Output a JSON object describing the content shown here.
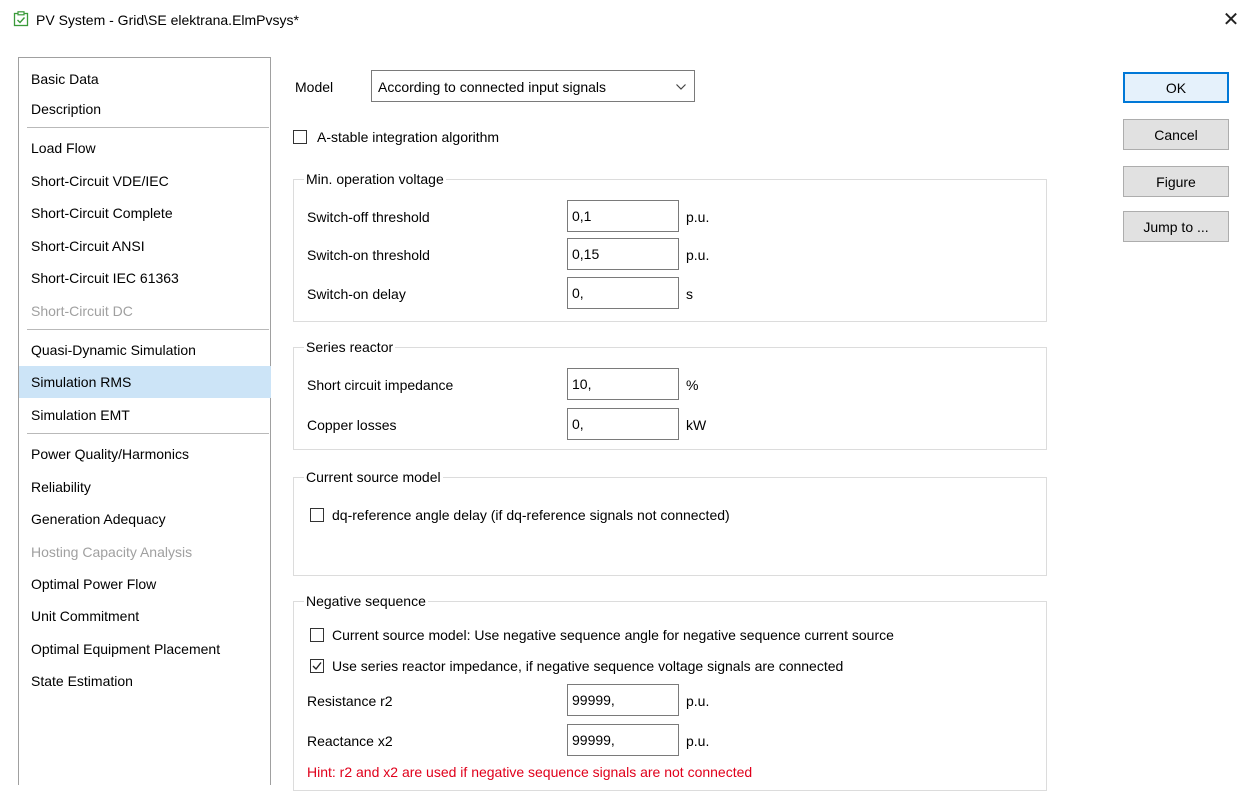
{
  "window": {
    "title": "PV System - Grid\\SE elektrana.ElmPvsys*",
    "close_glyph": "✕",
    "icon": "element-icon"
  },
  "sidebar": {
    "items": [
      {
        "label": "Basic Data"
      },
      {
        "label": "Description"
      },
      {
        "label": "Load Flow"
      },
      {
        "label": "Short-Circuit VDE/IEC"
      },
      {
        "label": "Short-Circuit Complete"
      },
      {
        "label": "Short-Circuit ANSI"
      },
      {
        "label": "Short-Circuit IEC 61363"
      },
      {
        "label": "Short-Circuit DC"
      },
      {
        "label": "Quasi-Dynamic Simulation"
      },
      {
        "label": "Simulation RMS"
      },
      {
        "label": "Simulation EMT"
      },
      {
        "label": "Power Quality/Harmonics"
      },
      {
        "label": "Reliability"
      },
      {
        "label": "Generation Adequacy"
      },
      {
        "label": "Hosting Capacity Analysis"
      },
      {
        "label": "Optimal Power Flow"
      },
      {
        "label": "Unit Commitment"
      },
      {
        "label": "Optimal Equipment Placement"
      },
      {
        "label": "State Estimation"
      }
    ],
    "selected": "Simulation RMS",
    "disabled": [
      "Short-Circuit DC",
      "Hosting Capacity Analysis"
    ]
  },
  "model": {
    "label": "Model",
    "value": "According to connected input signals"
  },
  "astable": {
    "label": "A-stable integration algorithm",
    "checked": false
  },
  "min_voltage": {
    "title": "Min. operation voltage",
    "switch_off": {
      "label": "Switch-off threshold",
      "value": "0,1",
      "unit": "p.u."
    },
    "switch_on": {
      "label": "Switch-on threshold",
      "value": "0,15",
      "unit": "p.u."
    },
    "delay": {
      "label": "Switch-on delay",
      "value": "0,",
      "unit": "s"
    }
  },
  "series_reactor": {
    "title": "Series reactor",
    "impedance": {
      "label": "Short circuit impedance",
      "value": "10,",
      "unit": "%"
    },
    "copper": {
      "label": "Copper losses",
      "value": "0,",
      "unit": "kW"
    }
  },
  "current_source": {
    "title": "Current source model",
    "dq_delay": {
      "label": "dq-reference angle delay (if dq-reference signals not connected)",
      "checked": false
    }
  },
  "negative_sequence": {
    "title": "Negative sequence",
    "cs_angle": {
      "label": "Current source model: Use negative sequence angle for negative sequence current source",
      "checked": false
    },
    "reactor_imp": {
      "label": "Use series reactor impedance, if negative sequence voltage signals are connected",
      "checked": true
    },
    "r2": {
      "label": "Resistance r2",
      "value": "99999,",
      "unit": "p.u."
    },
    "x2": {
      "label": "Reactance x2",
      "value": "99999,",
      "unit": "p.u."
    },
    "hint": "Hint: r2 and x2 are used if negative sequence signals are not connected"
  },
  "buttons": {
    "ok": "OK",
    "cancel": "Cancel",
    "figure": "Figure",
    "jump": "Jump to ..."
  },
  "colors": {
    "selection": "#cce4f7",
    "primary_border": "#0078d7",
    "hint": "#e0001b",
    "disabled_text": "#a0a0a0"
  }
}
